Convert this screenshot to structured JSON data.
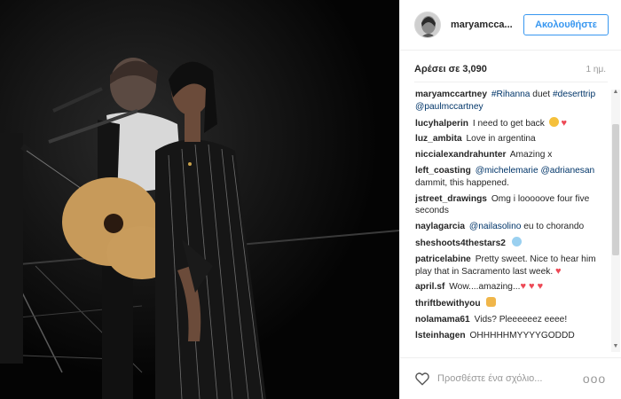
{
  "header": {
    "username": "maryamcca...",
    "follow_label": "Ακολουθήστε"
  },
  "stats": {
    "likes": "Αρέσει σε 3,090",
    "time": "1 ημ."
  },
  "caption": {
    "user": "maryamccartney",
    "tag1": "#Rihanna",
    "text1": " duet",
    "tag2": "#deserttrip",
    "mention": "@paulmccartney"
  },
  "comments": [
    {
      "user": "lucyhalperin",
      "text": "I need to get back"
    },
    {
      "user": "luz_ambita",
      "text": "Love in argentina"
    },
    {
      "user": "niccialexandrahunter",
      "text": "Amazing x"
    },
    {
      "user": "left_coasting",
      "m1": "@michelemarie",
      "m2": "@adrianesan",
      "text": " dammit, this happened."
    },
    {
      "user": "jstreet_drawings",
      "text": "Omg i looooove four five seconds"
    },
    {
      "user": "naylagarcia",
      "m1": "@nailasolino",
      "text": " eu to chorando"
    },
    {
      "user": "sheshoots4thestars2",
      "text": ""
    },
    {
      "user": "patricelabine",
      "text": "Pretty sweet. Nice to hear him play that in Sacramento last week."
    },
    {
      "user": "april.sf",
      "text": "Wow....amazing..."
    },
    {
      "user": "thriftbewithyou",
      "text": ""
    },
    {
      "user": "nolamama61",
      "text": "Vids? Pleeeeeez eeee!"
    },
    {
      "user": "lsteinhagen",
      "text": "OHHHHHMYYYYGODDD"
    }
  ],
  "footer": {
    "comment_placeholder": "Προσθέστε ένα σχόλιο...",
    "more_label": "ooo"
  },
  "colors": {
    "accent": "#3897f0",
    "link": "#003569",
    "heart": "#ed4956"
  }
}
